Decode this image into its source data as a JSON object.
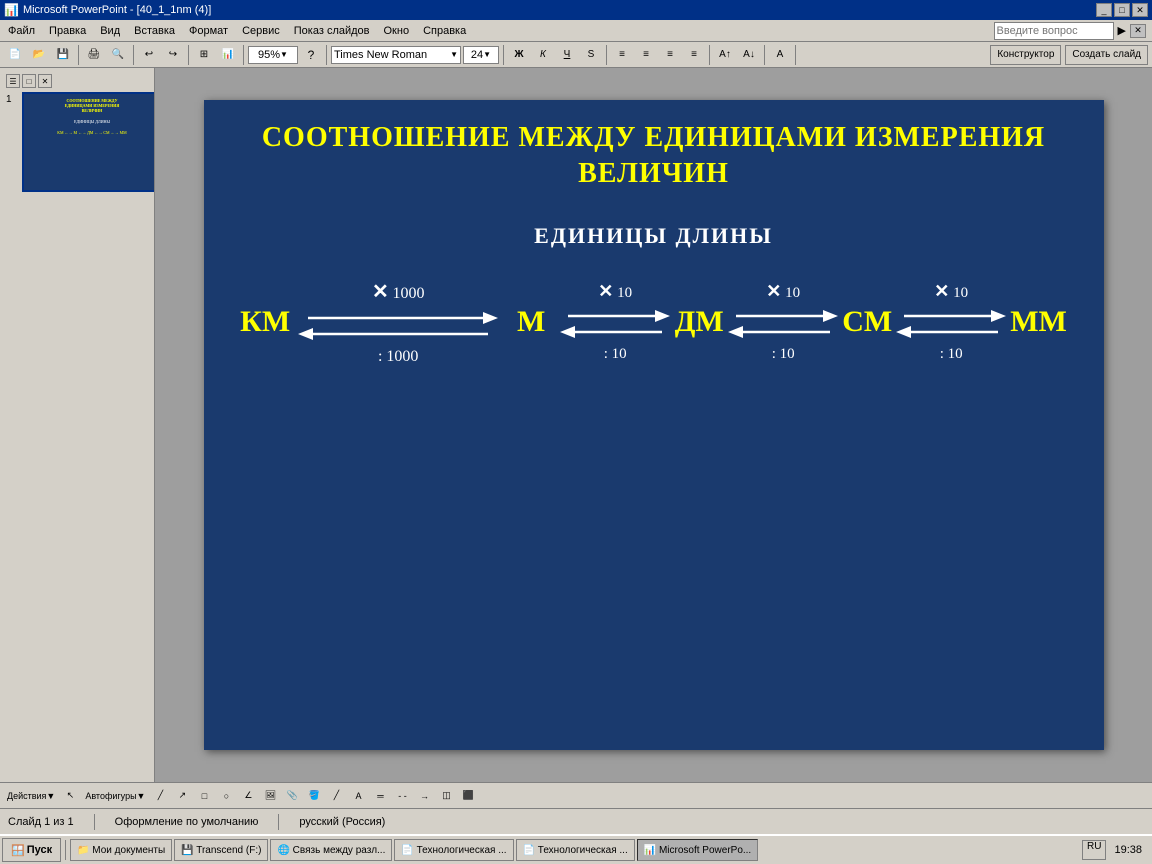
{
  "window": {
    "title": "Microsoft PowerPoint - [40_1_1nm (4)]",
    "title_icon": "ppt-icon"
  },
  "menu": {
    "items": [
      "Файл",
      "Правка",
      "Вид",
      "Вставка",
      "Формат",
      "Сервис",
      "Показ слайдов",
      "Окно",
      "Справка"
    ],
    "ask_placeholder": "Введите вопрос"
  },
  "toolbar": {
    "zoom": "95%",
    "font": "Times New Roman",
    "size": "24",
    "bold": "Ж",
    "italic": "К",
    "underline": "Ч",
    "strikethrough": "S",
    "construct_label": "Конструктор",
    "create_slide_label": "Создать слайд"
  },
  "slide": {
    "title": "СООТНОШЕНИЕ МЕЖДУ ЕДИНИЦАМИ ИЗМЕРЕНИЯ ВЕЛИЧИН",
    "subtitle": "ЕДИНИЦЫ ДЛИНЫ",
    "units": [
      "КМ",
      "М",
      "ДМ",
      "СМ",
      "МM"
    ],
    "arrows": [
      {
        "multiply": "× 1000",
        "divide": ": 1000"
      },
      {
        "multiply": "× 10",
        "divide": ": 10"
      },
      {
        "multiply": "× 10",
        "divide": ": 10"
      },
      {
        "multiply": "× 10",
        "divide": ": 10"
      }
    ]
  },
  "status": {
    "slide_info": "Слайд 1 из 1",
    "design": "Оформление по умолчанию",
    "language": "русский (Россия)"
  },
  "taskbar": {
    "start": "Пуск",
    "time": "19:38",
    "lang": "RU",
    "tasks": [
      "Мои документы",
      "Transcend (F:)",
      "Связь между разл...",
      "Технологическая ...",
      "Технологическая ...",
      "Microsoft PowerPo..."
    ]
  }
}
